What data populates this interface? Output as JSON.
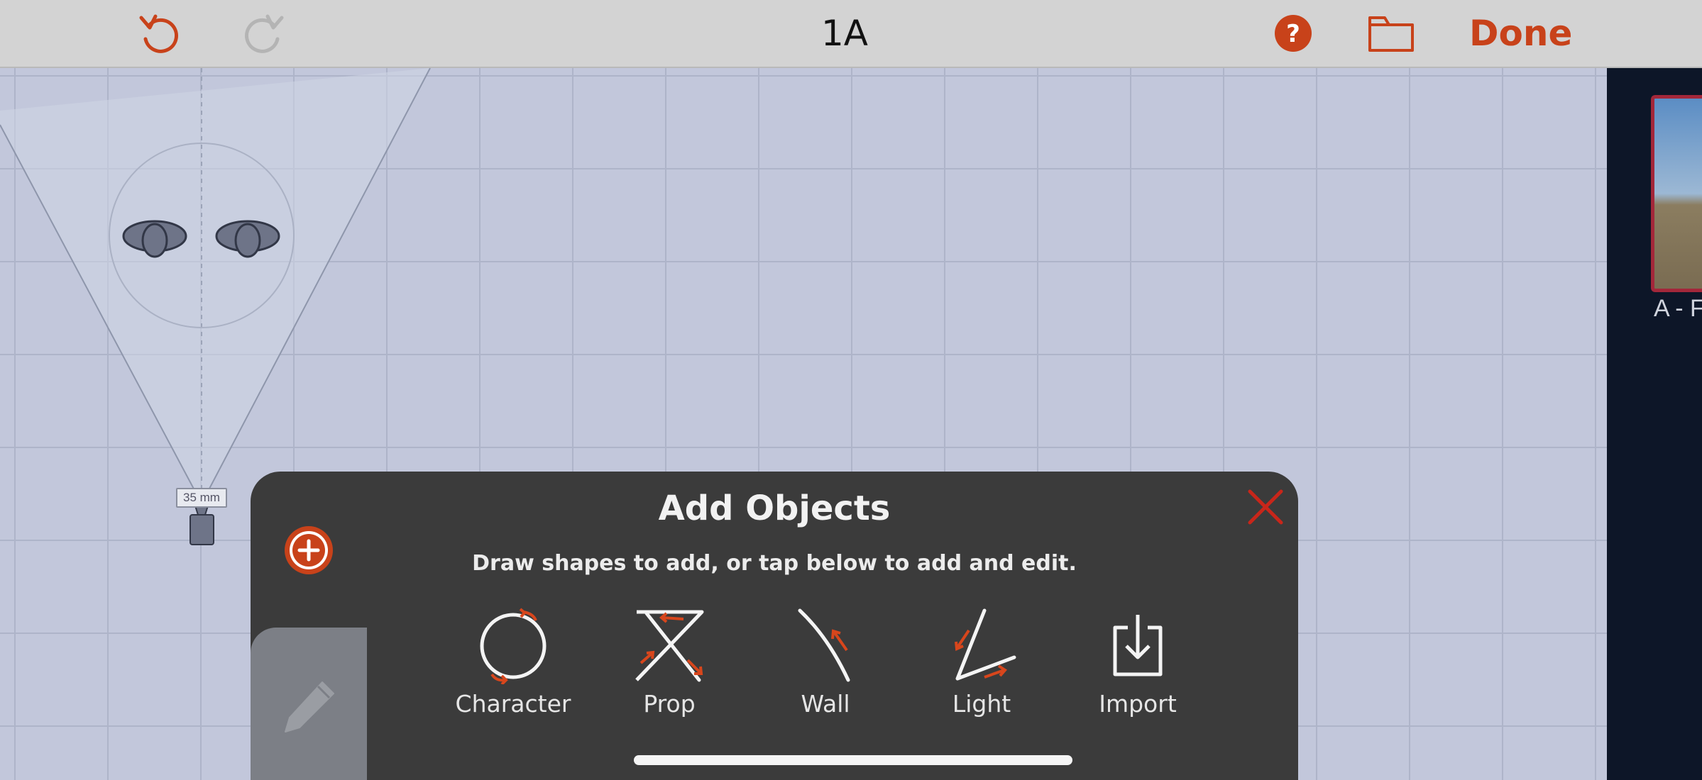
{
  "title": "1A",
  "toolbar": {
    "done_label": "Done"
  },
  "icons": {
    "undo": "undo-icon",
    "redo": "redo-icon",
    "help": "help-icon",
    "folder": "folder-icon",
    "close": "close-icon",
    "add": "plus-circle-icon",
    "pencil": "pencil-icon"
  },
  "scene": {
    "camera_lens": "35 mm"
  },
  "shot_panel": {
    "shot_label": "A - F"
  },
  "add_objects": {
    "title": "Add Objects",
    "subtitle": "Draw shapes to add, or tap below to add and edit.",
    "tools": [
      {
        "label": "Character",
        "icon": "character-gesture-icon"
      },
      {
        "label": "Prop",
        "icon": "prop-gesture-icon"
      },
      {
        "label": "Wall",
        "icon": "wall-gesture-icon"
      },
      {
        "label": "Light",
        "icon": "light-gesture-icon"
      },
      {
        "label": "Import",
        "icon": "import-icon"
      }
    ]
  },
  "colors": {
    "accent": "#c8421a",
    "panel": "#3b3b3b",
    "toolbar": "#d3d3d3",
    "grid": "#c2c7db",
    "sidebar": "#0d1628"
  }
}
